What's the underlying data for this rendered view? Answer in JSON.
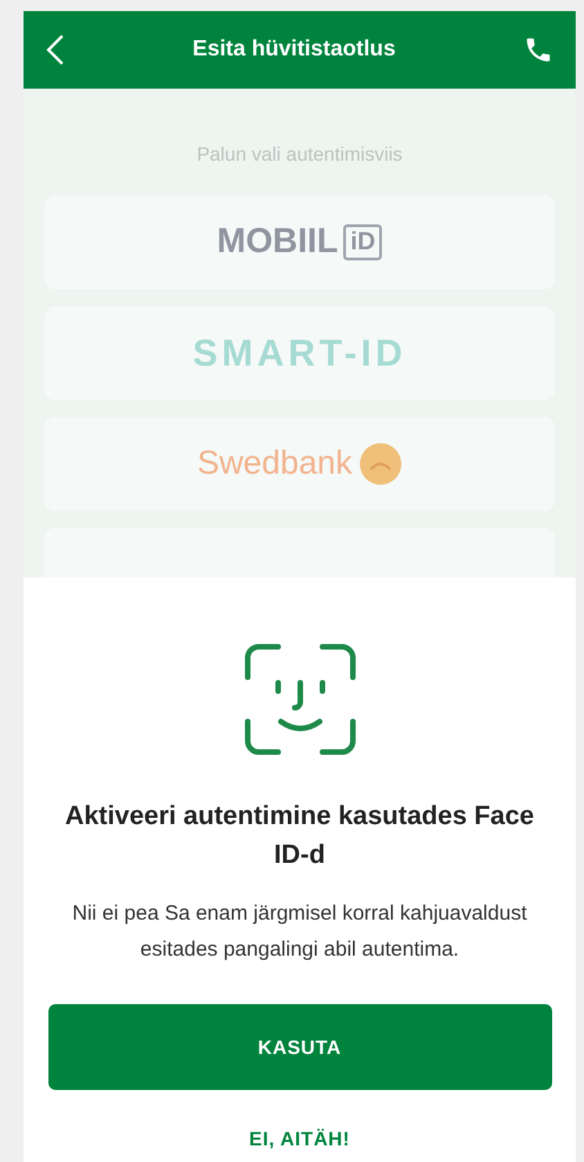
{
  "header": {
    "title": "Esita hüvitistaotlus"
  },
  "prompt": "Palun vali autentimisviis",
  "methods": [
    {
      "kind": "mobiil",
      "label": "MOBIIL",
      "badge": "iD"
    },
    {
      "kind": "smart",
      "label": "SMART-ID"
    },
    {
      "kind": "swedbank",
      "label": "Swedbank"
    },
    {
      "kind": "partial"
    }
  ],
  "sheet": {
    "title": "Aktiveeri autentimine kasutades Face ID-d",
    "text": "Nii ei pea Sa enam järgmisel korral kahjuavaldust esitades pangalingi abil autentima.",
    "primary_button": "KASUTA",
    "secondary_button": "EI, AITÄH!"
  }
}
